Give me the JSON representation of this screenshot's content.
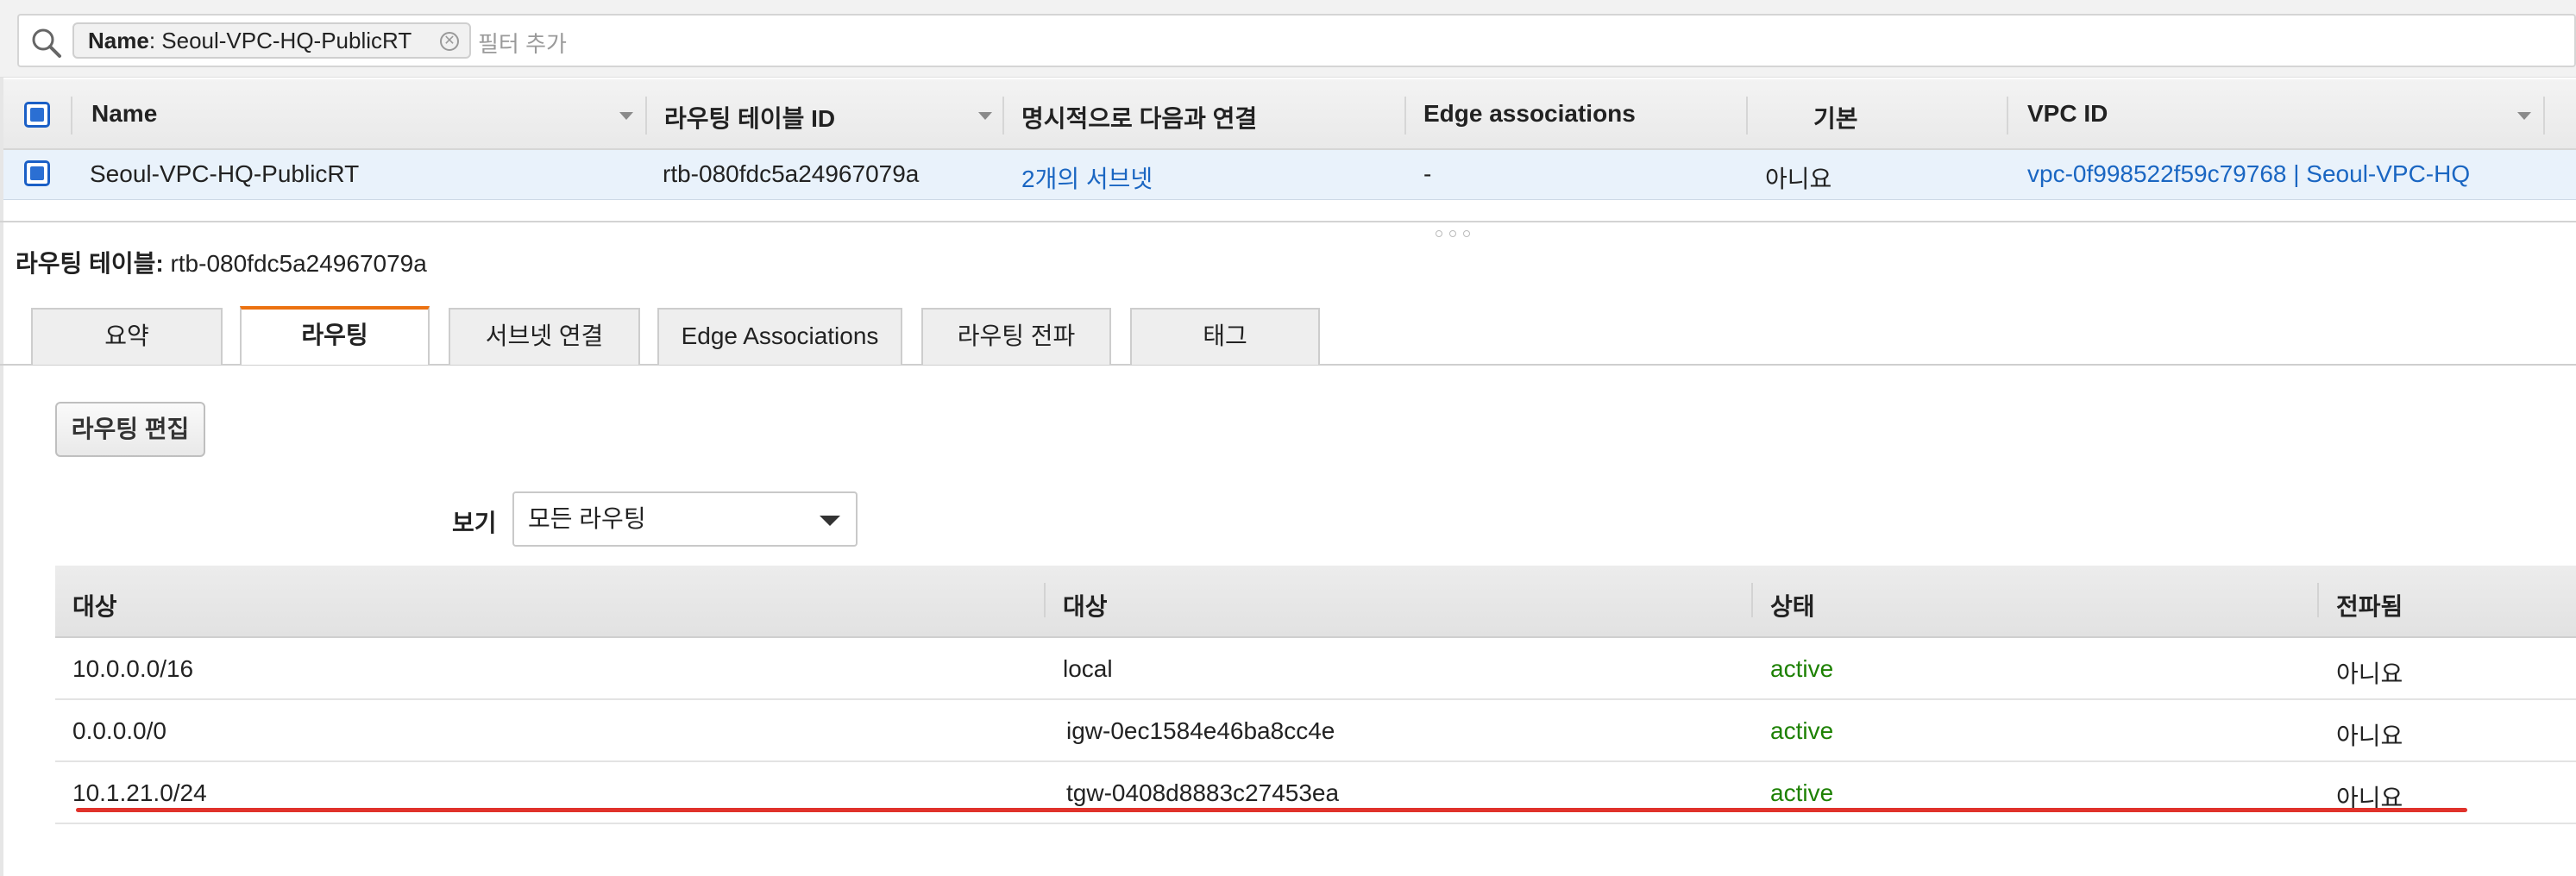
{
  "search": {
    "chip_key": "Name",
    "chip_value": ": Seoul-VPC-HQ-PublicRT",
    "placeholder": "필터 추가",
    "icon": "search-icon"
  },
  "top_table": {
    "columns": [
      "Name",
      "라우팅 테이블 ID",
      "명시적으로 다음과 연결",
      "Edge associations",
      "기본",
      "VPC ID"
    ],
    "row": {
      "name": "Seoul-VPC-HQ-PublicRT",
      "rtb_id": "rtb-080fdc5a24967079a",
      "explicit": "2개의 서브넷",
      "edge": "-",
      "main": "아니요",
      "vpc": "vpc-0f998522f59c79768 | Seoul-VPC-HQ"
    }
  },
  "detail": {
    "title_label": "라우팅 테이블:",
    "title_value": "rtb-080fdc5a24967079a"
  },
  "tabs": [
    {
      "label": "요약"
    },
    {
      "label": "라우팅"
    },
    {
      "label": "서브넷 연결"
    },
    {
      "label": "Edge Associations"
    },
    {
      "label": "라우팅 전파"
    },
    {
      "label": "태그"
    }
  ],
  "routes": {
    "edit_button": "라우팅 편집",
    "view_label": "보기",
    "view_selected": "모든 라우팅",
    "columns": [
      "대상",
      "대상",
      "상태",
      "전파됨"
    ],
    "rows": [
      {
        "destination": "10.0.0.0/16",
        "target": "local",
        "status": "active",
        "propagated": "아니요"
      },
      {
        "destination": "0.0.0.0/0",
        "target": "igw-0ec1584e46ba8cc4e",
        "status": "active",
        "propagated": "아니요"
      },
      {
        "destination": "10.1.21.0/24",
        "target": "tgw-0408d8883c27453ea",
        "status": "active",
        "propagated": "아니요"
      }
    ]
  },
  "colors": {
    "link": "#1a66c2",
    "active": "#1d8102",
    "tab_accent": "#ec7211",
    "annotation": "#e0322b"
  }
}
